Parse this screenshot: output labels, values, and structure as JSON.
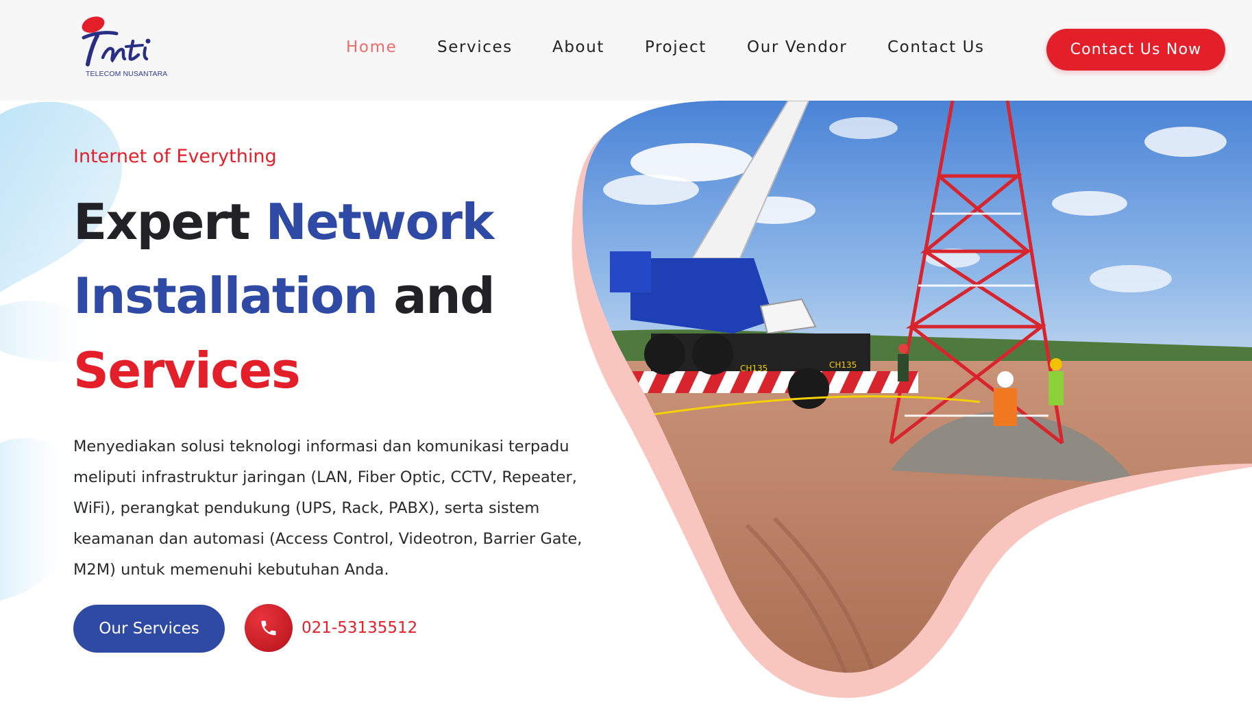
{
  "brand": {
    "logo_text": "Inti",
    "logo_subtitle": "TELECOM NUSANTARA"
  },
  "nav": {
    "items": [
      {
        "label": "Home",
        "active": true
      },
      {
        "label": "Services",
        "active": false
      },
      {
        "label": "About",
        "active": false
      },
      {
        "label": "Project",
        "active": false
      },
      {
        "label": "Our Vendor",
        "active": false
      },
      {
        "label": "Contact Us",
        "active": false
      }
    ],
    "cta_label": "Contact Us Now"
  },
  "hero": {
    "eyebrow": "Internet of Everything",
    "headline": {
      "w1": "Expert",
      "w2": "Network",
      "w3": "Installation",
      "w4": "and",
      "w5": "Services"
    },
    "description": "Menyediakan solusi teknologi informasi dan komunikasi terpadu meliputi infrastruktur jaringan (LAN, Fiber Optic, CCTV, Repeater, WiFi), perangkat pendukung (UPS, Rack, PABX), serta sistem keamanan dan automasi (Access Control, Videotron, Barrier Gate, M2M) untuk memenuhi kebutuhan Anda.",
    "primary_button": "Our Services",
    "phone_number": "021-53135512",
    "phone_icon": "phone-icon",
    "image_subject": "crane-and-telecom-tower-photo",
    "crane_labels": [
      "CH135",
      "CH135"
    ]
  },
  "colors": {
    "brand_red": "#e3202a",
    "brand_blue": "#2e4aa4",
    "nav_active": "#ef6a6a",
    "text_dark": "#222226",
    "blob_pink": "#f9c6bf",
    "blob_light_blue": "#cfeaf8"
  }
}
